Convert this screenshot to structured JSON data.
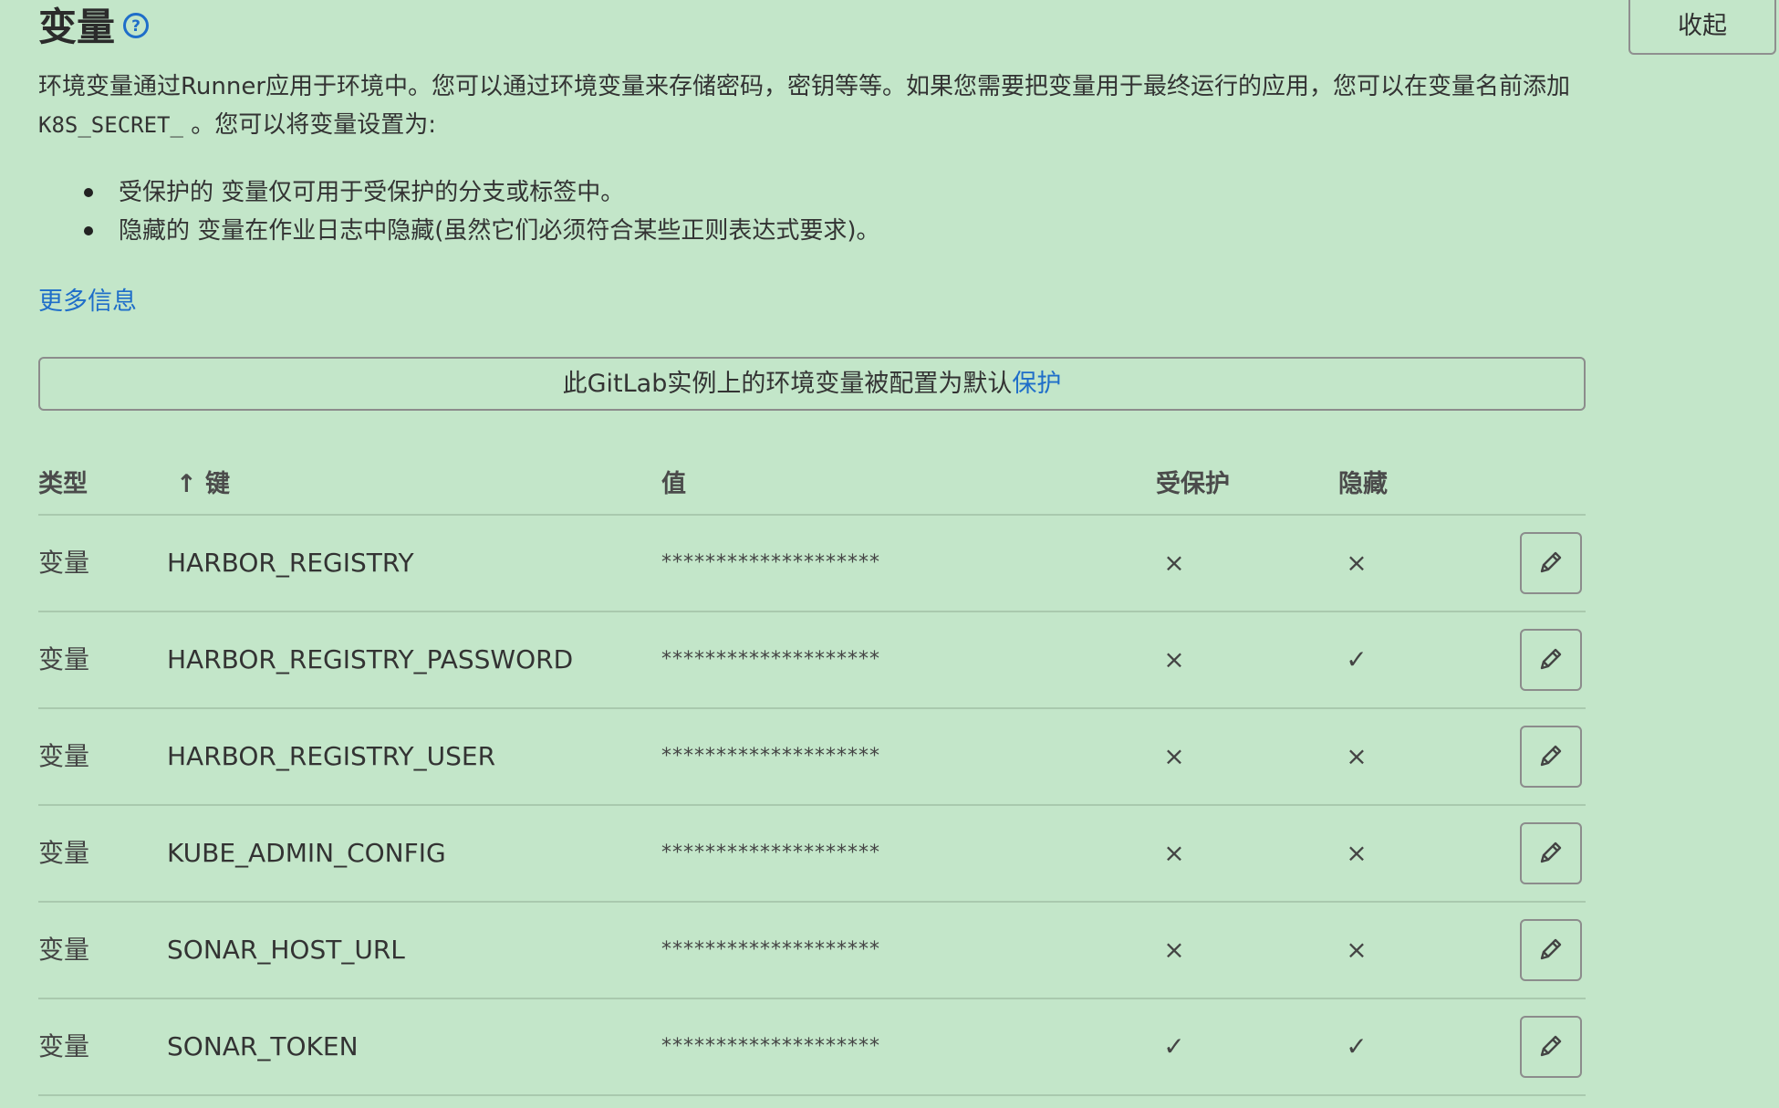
{
  "header": {
    "title": "变量",
    "collapse_label": "收起"
  },
  "description": {
    "part1": "环境变量通过Runner应用于环境中。您可以通过环境变量来存储密码，密钥等等。如果您需要把变量用于最终运行的应用，您可以在变量名前添加",
    "code": "K8S_SECRET_",
    "part2": "。您可以将变量设置为:"
  },
  "bullets": [
    "受保护的 变量仅可用于受保护的分支或标签中。",
    "隐藏的 变量在作业日志中隐藏(虽然它们必须符合某些正则表达式要求)。"
  ],
  "more_info_label": "更多信息",
  "notice": {
    "text": "此GitLab实例上的环境变量被配置为默认",
    "link": "保护"
  },
  "table": {
    "headers": {
      "type": "类型",
      "key": "↑ 键",
      "value": "值",
      "protected": "受保护",
      "masked": "隐藏"
    },
    "rows": [
      {
        "type": "变量",
        "key": "HARBOR_REGISTRY",
        "value": "********************",
        "protected": "×",
        "masked": "×"
      },
      {
        "type": "变量",
        "key": "HARBOR_REGISTRY_PASSWORD",
        "value": "********************",
        "protected": "×",
        "masked": "✓"
      },
      {
        "type": "变量",
        "key": "HARBOR_REGISTRY_USER",
        "value": "********************",
        "protected": "×",
        "masked": "×"
      },
      {
        "type": "变量",
        "key": "KUBE_ADMIN_CONFIG",
        "value": "********************",
        "protected": "×",
        "masked": "×"
      },
      {
        "type": "变量",
        "key": "SONAR_HOST_URL",
        "value": "********************",
        "protected": "×",
        "masked": "×"
      },
      {
        "type": "变量",
        "key": "SONAR_TOKEN",
        "value": "********************",
        "protected": "✓",
        "masked": "✓"
      }
    ]
  },
  "colors": {
    "background": "#c3e6c9",
    "link": "#1f6ec9"
  },
  "icons": {
    "help": "question-circle-icon",
    "edit": "pencil-icon"
  }
}
